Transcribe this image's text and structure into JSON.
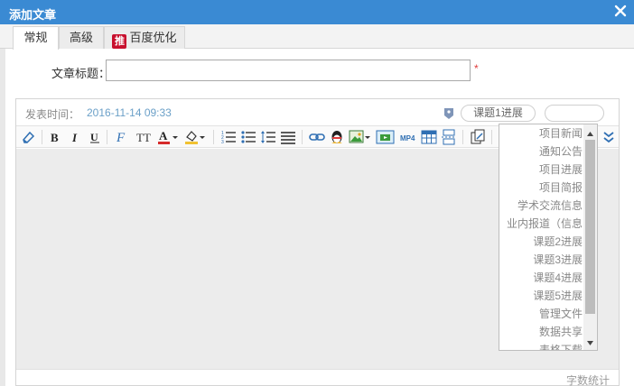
{
  "dialog": {
    "title": "添加文章",
    "close_icon": "close-icon"
  },
  "tabs": [
    {
      "label": "常规",
      "active": true
    },
    {
      "label": "高级",
      "active": false
    },
    {
      "label": "百度优化",
      "badge": "推",
      "active": false
    }
  ],
  "form": {
    "title_label": "文章标题：",
    "title_value": "",
    "required_mark": "*"
  },
  "editor": {
    "publish_label": "发表时间：",
    "publish_time": "2016-11-14 09:33",
    "category_select": "课题1进展",
    "second_select": "",
    "word_count": "字数统计"
  },
  "toolbar": {
    "icons": [
      "eraser-icon",
      "bold-icon",
      "italic-icon",
      "underline-icon",
      "font-family-icon",
      "font-size-icon",
      "font-color-icon",
      "highlight-icon",
      "ordered-list-icon",
      "unordered-list-icon",
      "line-height-icon",
      "justify-icon",
      "link-icon",
      "qq-icon",
      "image-icon",
      "insert-media-icon",
      "mp4-icon",
      "table-icon",
      "page-break-icon",
      "template-icon",
      "expand-icon"
    ],
    "bold_glyph": "B",
    "italic_glyph": "I",
    "underline_glyph": "U",
    "font_family_glyph": "F",
    "font_size_glyph": "TT",
    "font_color_glyph": "A",
    "mp4_glyph": "MP4"
  },
  "category_dropdown": {
    "items": [
      "项目新闻",
      "通知公告",
      "项目进展",
      "项目简报",
      "学术交流信息",
      "业内报道（信息",
      "课题2进展",
      "课题3进展",
      "课题4进展",
      "课题5进展",
      "管理文件",
      "数据共享",
      "表格下载"
    ]
  },
  "colors": {
    "titlebar": "#3a8ad3",
    "required": "#e03b3b",
    "baidu_badge": "#c8102e",
    "time_text": "#6ba0c8"
  }
}
